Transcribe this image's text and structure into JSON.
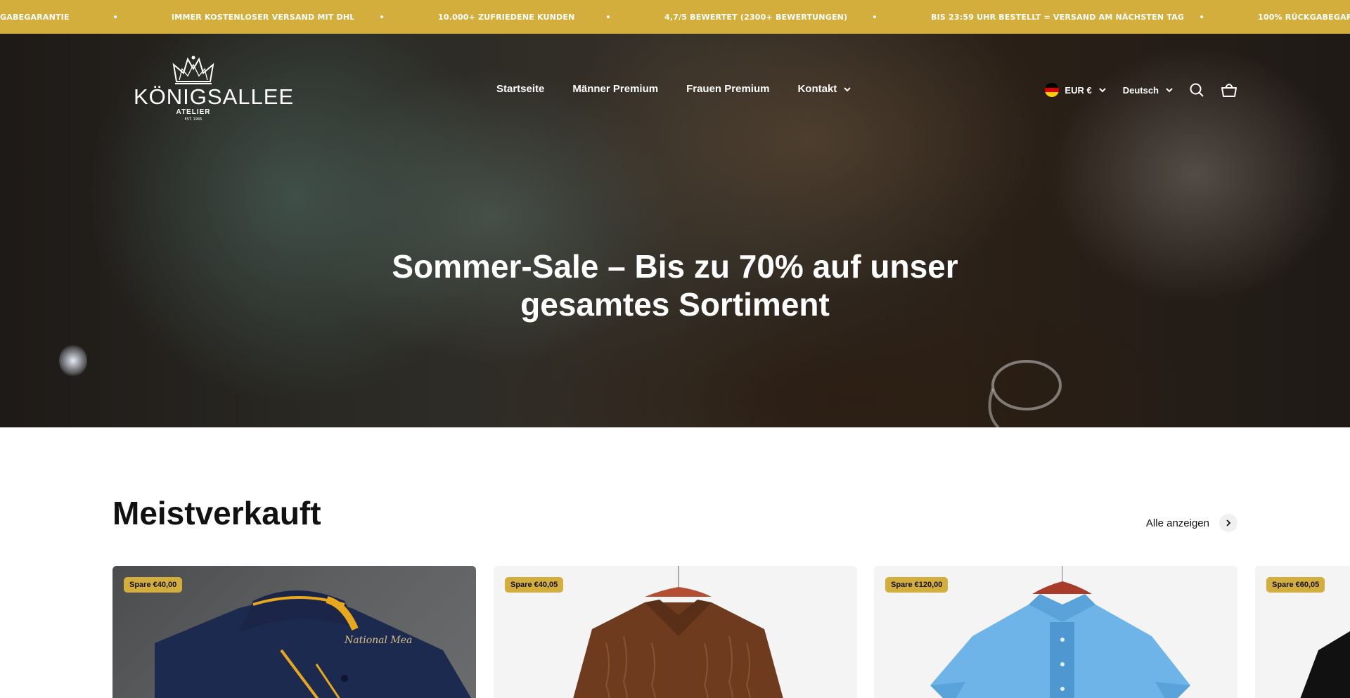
{
  "announcement": {
    "items": [
      "GABEGARANTIE",
      "IMMER KOSTENLOSER VERSAND MIT DHL",
      "10.000+ ZUFRIEDENE KUNDEN",
      "4,7/5 BEWERTET (2300+ BEWERTUNGEN)",
      "BIS 23:59 UHR BESTELLT = VERSAND AM NÄCHSTEN TAG",
      "100% RÜCKGABEGARAN"
    ],
    "color": "#d4ae3c"
  },
  "header": {
    "logo": {
      "main": "KÖNIGSALLEE",
      "sub": "ATELIER",
      "est": "EST. 1966"
    },
    "nav": [
      {
        "label": "Startseite"
      },
      {
        "label": "Männer Premium"
      },
      {
        "label": "Frauen Premium"
      },
      {
        "label": "Kontakt"
      }
    ],
    "currency": "EUR €",
    "language": "Deutsch"
  },
  "hero": {
    "title_line1": "Sommer-Sale – Bis zu 70% auf unser",
    "title_line2": "gesamtes Sortiment"
  },
  "bestseller": {
    "title": "Meistverkauft",
    "view_all": "Alle anzeigen",
    "products": [
      {
        "badge": "Spare €40,00",
        "image": "navy-polo-shirt"
      },
      {
        "badge": "Spare €40,05",
        "image": "brown-striped-shirt"
      },
      {
        "badge": "Spare €120,00",
        "image": "light-blue-shirt"
      },
      {
        "badge": "Spare €60,05",
        "image": "black-shirt"
      }
    ]
  }
}
